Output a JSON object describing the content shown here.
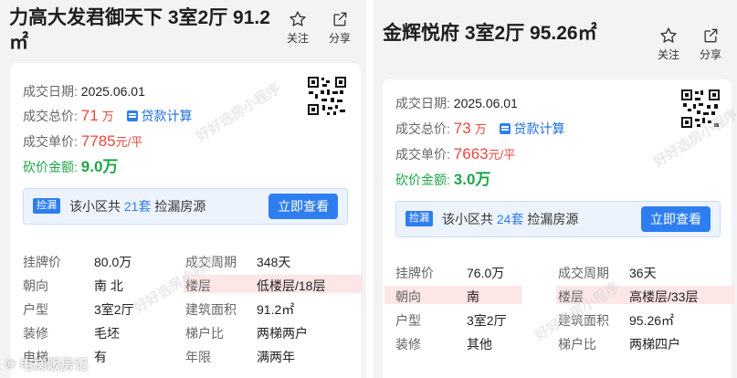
{
  "left": {
    "title": "力高大发君御天下 3室2厅 91.2㎡",
    "actions": {
      "follow": "关注",
      "share": "分享"
    },
    "deal_date_label": "成交日期:",
    "deal_date": "2025.06.01",
    "total_label": "成交总价:",
    "total_value": "71",
    "total_unit": "万",
    "loan_label": "贷款计算",
    "unit_price_label": "成交单价:",
    "unit_price_value": "7785",
    "unit_price_unit": "元/平",
    "cut_label": "砍价金额:",
    "cut_value": "9.0万",
    "banner": {
      "tag": "捡漏",
      "text_a": "该小区共",
      "count": "21套",
      "text_b": "捡漏房源",
      "button": "立即查看"
    },
    "rows": [
      {
        "k1": "挂牌价",
        "v1": "80.0万",
        "k2": "成交周期",
        "v2": "348天"
      },
      {
        "k1": "朝向",
        "v1": "南 北",
        "k2": "楼层",
        "v2": "低楼层/18层"
      },
      {
        "k1": "户型",
        "v1": "3室2厅",
        "k2": "建筑面积",
        "v2": "91.2㎡"
      },
      {
        "k1": "装修",
        "v1": "毛坯",
        "k2": "梯户比",
        "v2": "两梯两户"
      },
      {
        "k1": "电梯",
        "v1": "有",
        "k2": "年限",
        "v2": "满两年"
      }
    ]
  },
  "right": {
    "title": "金辉悦府 3室2厅 95.26㎡",
    "actions": {
      "follow": "关注",
      "share": "分享"
    },
    "deal_date_label": "成交日期:",
    "deal_date": "2025.06.01",
    "total_label": "成交总价:",
    "total_value": "73",
    "total_unit": "万",
    "loan_label": "贷款计算",
    "unit_price_label": "成交单价:",
    "unit_price_value": "7663",
    "unit_price_unit": "元/平",
    "cut_label": "砍价金额:",
    "cut_value": "3.0万",
    "banner": {
      "tag": "捡漏",
      "text_a": "该小区共",
      "count": "24套",
      "text_b": "捡漏房源",
      "button": "立即查看"
    },
    "rows": [
      {
        "k1": "挂牌价",
        "v1": "76.0万",
        "k2": "成交周期",
        "v2": "36天"
      },
      {
        "k1": "朝向",
        "v1": "南",
        "k2": "楼层",
        "v2": "高楼层/33层"
      },
      {
        "k1": "户型",
        "v1": "3室2厅",
        "k2": "建筑面积",
        "v2": "95.26㎡"
      },
      {
        "k1": "装修",
        "v1": "其他",
        "k2": "梯户比",
        "v2": "两梯四户"
      }
    ]
  },
  "watermark": "好好选房小程序",
  "corner_watermark": "© 电梯贩房记",
  "colors": {
    "accent": "#2f7ef0",
    "price_red": "#e9463d",
    "cut_green": "#1fa54a",
    "highlight": "#fde6e6"
  },
  "icons": {
    "follow": "star-icon",
    "share": "share-icon",
    "qr": "qr-code-icon",
    "loan": "calculator-icon"
  }
}
